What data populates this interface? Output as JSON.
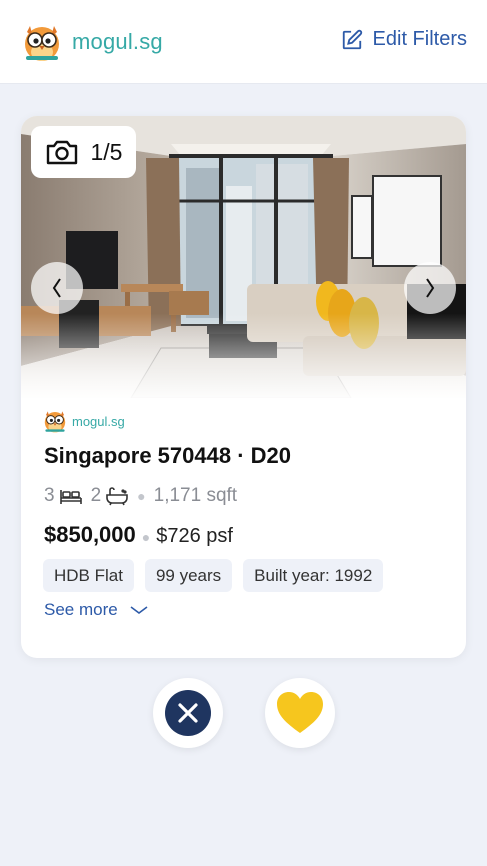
{
  "header": {
    "brand": "mogul.sg",
    "edit_filters_label": "Edit Filters"
  },
  "listing": {
    "photo_counter": "1/5",
    "source_brand": "mogul.sg",
    "title": "Singapore 570448 · D20",
    "bedrooms": "3",
    "bathrooms": "2",
    "area": "1,171 sqft",
    "price": "$850,000",
    "psf": "$726 psf",
    "tags": [
      "HDB Flat",
      "99 years",
      "Built year: 1992"
    ],
    "see_more_label": "See more"
  },
  "colors": {
    "brand_teal": "#36a9a6",
    "accent_blue": "#2d5aa8",
    "reject_navy": "#1f3560",
    "like_yellow": "#f6c61e",
    "page_bg": "#eef1f8"
  },
  "icons": {
    "edit": "edit-icon",
    "camera": "camera-icon",
    "prev": "chevron-left-icon",
    "next": "chevron-right-icon",
    "bed": "bed-icon",
    "bath": "bathtub-icon",
    "see_more": "chevron-down-icon",
    "reject": "close-icon",
    "like": "heart-icon"
  }
}
